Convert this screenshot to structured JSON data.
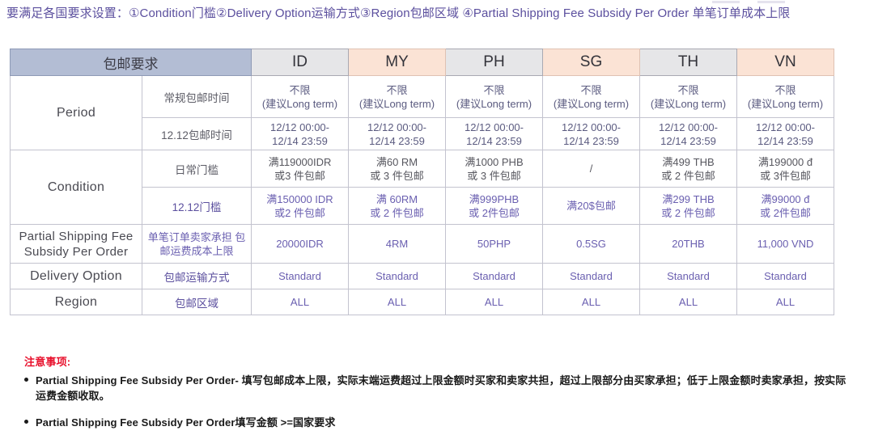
{
  "intro": {
    "text": "要满足各国要求设置：①Condition门槛②Delivery Option运输方式③Region包邮区域 ④Partial Shipping Fee Subsidy Per Order 单笔订单成本上限"
  },
  "table": {
    "header": {
      "requirement_label": "包邮要求",
      "countries": [
        "ID",
        "MY",
        "PH",
        "SG",
        "TH",
        "VN"
      ]
    },
    "rows": [
      {
        "group": "Period",
        "sub": "常规包邮时间",
        "values": [
          {
            "l1": "不限",
            "l2": "(建议Long term)"
          },
          {
            "l1": "不限",
            "l2": "(建议Long term)"
          },
          {
            "l1": "不限",
            "l2": "(建议Long term)"
          },
          {
            "l1": "不限",
            "l2": "(建议Long term)"
          },
          {
            "l1": "不限",
            "l2": "(建议Long term)"
          },
          {
            "l1": "不限",
            "l2": "(建议Long term)"
          }
        ]
      },
      {
        "group": "",
        "sub": "12.12包邮时间",
        "values": [
          {
            "l1": "12/12 00:00-",
            "l2": "12/14 23:59"
          },
          {
            "l1": "12/12 00:00-",
            "l2": "12/14 23:59"
          },
          {
            "l1": "12/12 00:00-",
            "l2": "12/14 23:59"
          },
          {
            "l1": "12/12 00:00-",
            "l2": "12/14 23:59"
          },
          {
            "l1": "12/12 00:00-",
            "l2": "12/14 23:59"
          },
          {
            "l1": "12/12 00:00-",
            "l2": "12/14 23:59"
          }
        ]
      },
      {
        "group": "Condition",
        "sub": "日常门槛",
        "values": [
          {
            "l1": "满119000IDR",
            "l2": "或3 件包邮"
          },
          {
            "l1": "满60 RM",
            "l2": "或 3 件包邮"
          },
          {
            "l1": "满1000 PHB",
            "l2": "或 3 件包邮"
          },
          {
            "l1": "/",
            "l2": ""
          },
          {
            "l1": "满499 THB",
            "l2": "或 2 件包邮"
          },
          {
            "l1": "满199000 đ",
            "l2": "或 3件包邮"
          }
        ]
      },
      {
        "group": "",
        "sub": "12.12门槛",
        "values": [
          {
            "l1": "满150000 IDR",
            "l2": "或2 件包邮"
          },
          {
            "l1": "满 60RM",
            "l2": "或 2 件包邮"
          },
          {
            "l1": "满999PHB",
            "l2": "或 2件包邮"
          },
          {
            "l1": "满20$包邮",
            "l2": ""
          },
          {
            "l1": "满299 THB",
            "l2": "或 2 件包邮"
          },
          {
            "l1": "满99000 đ",
            "l2": "或 2件包邮"
          }
        ]
      }
    ],
    "psf": {
      "label_l1": "Partial Shipping Fee",
      "label_l2": "Subsidy Per Order",
      "sub_l1": "单笔订单卖家承担 包",
      "sub_l2": "邮运费成本上限",
      "values": [
        "20000IDR",
        "4RM",
        "50PHP",
        "0.5SG",
        "20THB",
        "11,000 VND"
      ]
    },
    "delivery": {
      "label": "Delivery Option",
      "sub": "包邮运输方式",
      "values": [
        "Standard",
        "Standard",
        "Standard",
        "Standard",
        "Standard",
        "Standard"
      ]
    },
    "region": {
      "label": "Region",
      "sub": "包邮区域",
      "values": [
        "ALL",
        "ALL",
        "ALL",
        "ALL",
        "ALL",
        "ALL"
      ]
    }
  },
  "notes": {
    "title": "注意事项:",
    "items": [
      "Partial Shipping Fee Subsidy Per Order- 填写包邮成本上限，实际末端运费超过上限金额时买家和卖家共担，超过上限部分由买家承担；低于上限金额时卖家承担，按实际运费金额收取。",
      "Partial Shipping Fee Subsidy Per Order填写金额 >=国家要求"
    ]
  },
  "colors": {
    "header_main": "#b3bdd4",
    "header_gray": "#e6e6e8",
    "header_peach": "#fbe3d5",
    "purple_text": "#5b4f9e",
    "note_red": "#e8112d",
    "border": "#c3c3cf"
  }
}
